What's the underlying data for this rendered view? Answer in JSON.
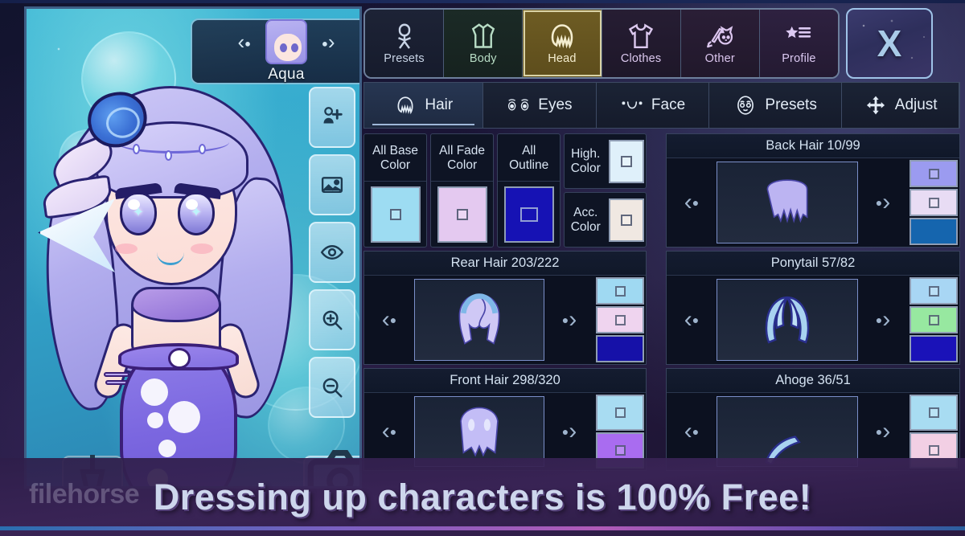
{
  "character_panel": {
    "name_bar": {
      "prev_label": "‹",
      "next_label": "›",
      "character_name": "Aqua",
      "avatar_icon": "character-avatar-icon"
    },
    "tools": [
      {
        "icon": "add-person-icon",
        "name": "add-character"
      },
      {
        "icon": "image-icon",
        "name": "background"
      },
      {
        "icon": "eye-icon",
        "name": "preview-toggle"
      },
      {
        "icon": "zoom-in-icon",
        "name": "zoom-in"
      },
      {
        "icon": "zoom-out-icon",
        "name": "zoom-out"
      }
    ],
    "camera_icon": "camera-icon",
    "menu_icon": "menu-icon"
  },
  "main_tabs": [
    {
      "label": "Presets",
      "icon": "mannequin-icon",
      "active": false,
      "theme": "presets"
    },
    {
      "label": "Body",
      "icon": "jacket-icon",
      "active": false,
      "theme": "body"
    },
    {
      "label": "Head",
      "icon": "hair-icon",
      "active": true,
      "theme": "head"
    },
    {
      "label": "Clothes",
      "icon": "tshirt-icon",
      "active": false,
      "theme": "clothes"
    },
    {
      "label": "Other",
      "icon": "sword-cat-icon",
      "active": false,
      "theme": "other"
    },
    {
      "label": "Profile",
      "icon": "star-list-icon",
      "active": false,
      "theme": "profile"
    }
  ],
  "close_button": {
    "label": "X",
    "name": "close-editor"
  },
  "sub_tabs": [
    {
      "label": "Hair",
      "icon": "hair-icon",
      "active": true
    },
    {
      "label": "Eyes",
      "icon": "eyes-icon",
      "active": false
    },
    {
      "label": "Face",
      "icon": "face-icon",
      "active": false
    },
    {
      "label": "Presets",
      "icon": "presets-face-icon",
      "active": false
    },
    {
      "label": "Adjust",
      "icon": "move-arrows-icon",
      "active": false
    }
  ],
  "color_controls": {
    "all_base": {
      "label_line1": "All Base",
      "label_line2": "Color",
      "color": "#9ddcf2"
    },
    "all_fade": {
      "label_line1": "All Fade",
      "label_line2": "Color",
      "color": "#e4c9f0"
    },
    "all_outline": {
      "label_line1": "All",
      "label_line2": "Outline",
      "color": "#1612b4"
    },
    "high_color": {
      "label_line1": "High.",
      "label_line2": "Color",
      "color": "#dff0fa"
    },
    "acc_color": {
      "label_line1": "Acc.",
      "label_line2": "Color",
      "color": "#f0e8e2"
    }
  },
  "item_panels": [
    {
      "key": "back_hair",
      "title": "Back Hair 10/99",
      "name": "Back Hair",
      "index": 10,
      "total": 99,
      "prev": "‹",
      "next": "›",
      "preview_icon": "back-hair-icon",
      "swatches": [
        "#9b9bf0",
        "#e8dcf4",
        "#1565ae"
      ]
    },
    {
      "key": "rear_hair",
      "title": "Rear Hair 203/222",
      "name": "Rear Hair",
      "index": 203,
      "total": 222,
      "prev": "‹",
      "next": "›",
      "preview_icon": "rear-hair-icon",
      "swatches": [
        "#9fd9f2",
        "#efd4ef",
        "#1611a8"
      ]
    },
    {
      "key": "ponytail",
      "title": "Ponytail 57/82",
      "name": "Ponytail",
      "index": 57,
      "total": 82,
      "prev": "‹",
      "next": "›",
      "preview_icon": "ponytail-icon",
      "swatches": [
        "#a8d6f4",
        "#97e8a0",
        "#1a12b8"
      ]
    },
    {
      "key": "front_hair",
      "title": "Front Hair 298/320",
      "name": "Front Hair",
      "index": 298,
      "total": 320,
      "prev": "‹",
      "next": "›",
      "preview_icon": "front-hair-icon",
      "swatches": [
        "#a8dcf2",
        "#a濾"
      ]
    },
    {
      "key": "ahoge",
      "title": "Ahoge 36/51",
      "name": "Ahoge",
      "index": 36,
      "total": 51,
      "prev": "‹",
      "next": "›",
      "preview_icon": "ahoge-icon",
      "swatches": [
        "#a8dcf2",
        "#f2cfe4"
      ]
    }
  ],
  "item_panel_swatch_overrides": {
    "front_hair": [
      "#a8dcf2",
      "#a96cf0"
    ],
    "ahoge": [
      "#a8dcf2",
      "#f2cfe4"
    ]
  },
  "banner": {
    "text": "Dressing up characters is 100% Free!"
  },
  "watermark": {
    "text": "filehorse"
  }
}
